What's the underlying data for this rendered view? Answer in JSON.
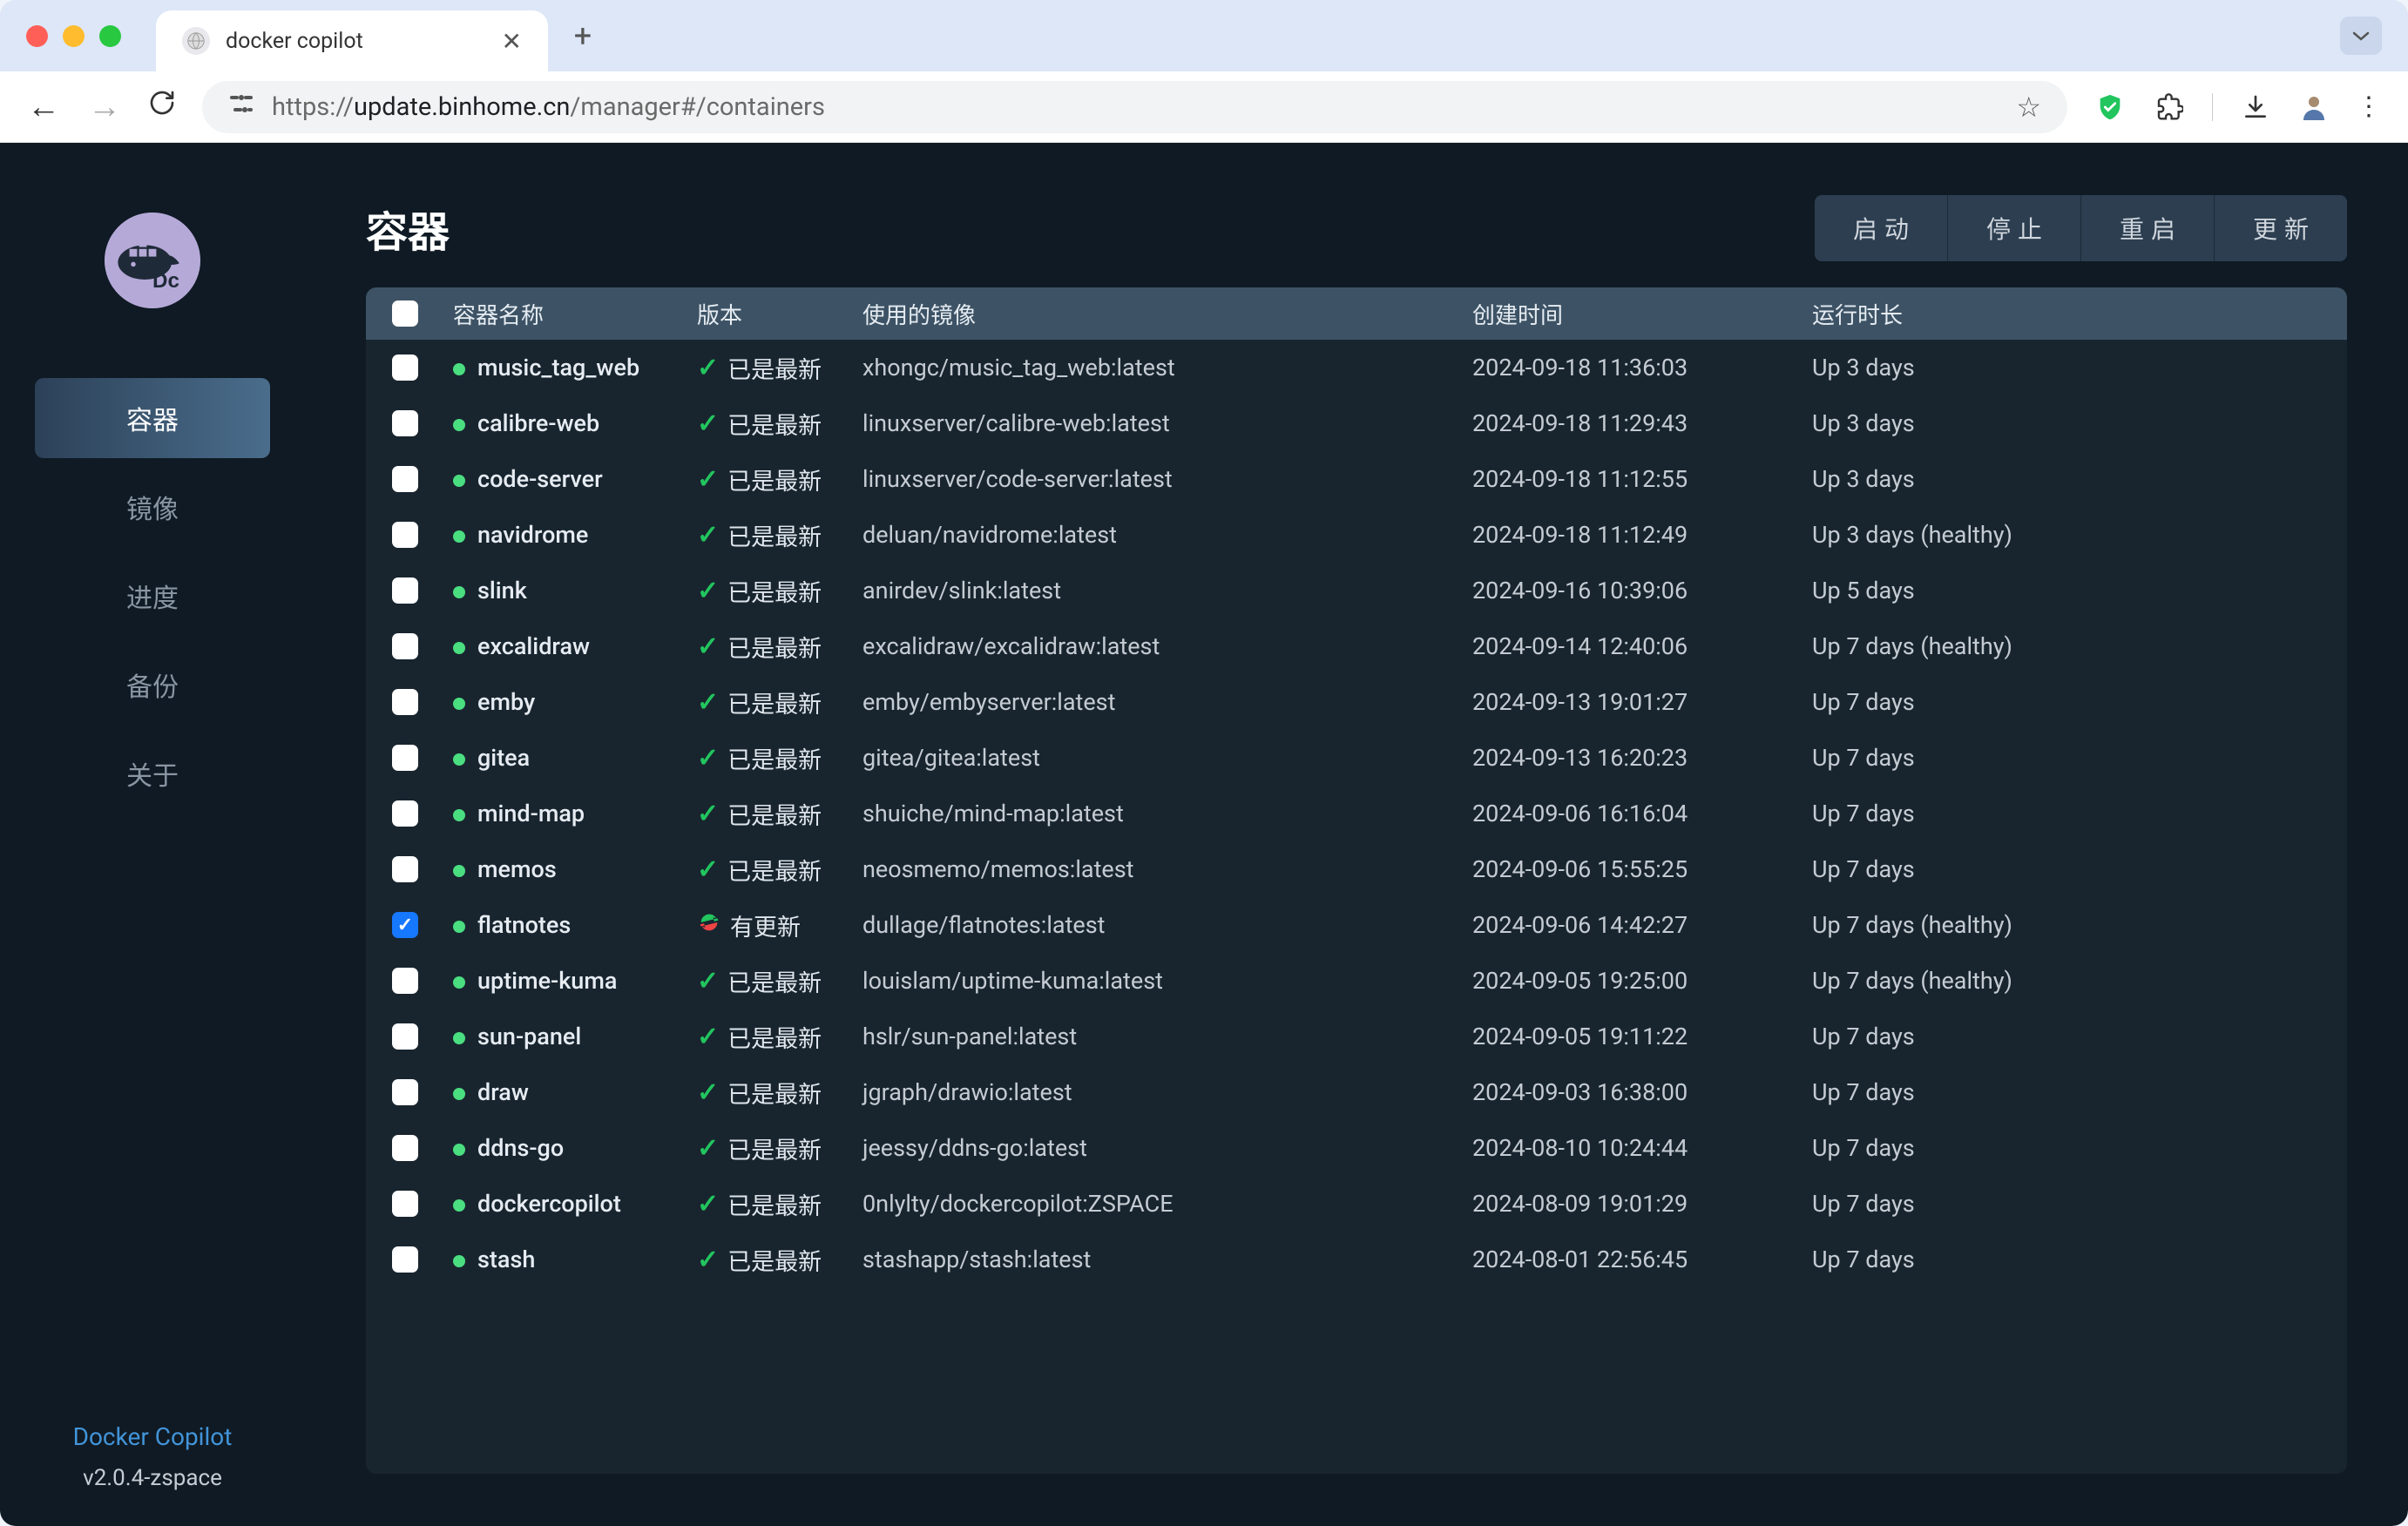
{
  "browser": {
    "tab_title": "docker copilot",
    "url_prefix": "https://",
    "url_host": "update.binhome.cn",
    "url_path": "/manager#/containers"
  },
  "sidebar": {
    "items": [
      {
        "label": "容器",
        "active": true
      },
      {
        "label": "镜像",
        "active": false
      },
      {
        "label": "进度",
        "active": false
      },
      {
        "label": "备份",
        "active": false
      },
      {
        "label": "关于",
        "active": false
      }
    ],
    "footer_name": "Docker Copilot",
    "footer_version": "v2.0.4-zspace"
  },
  "page": {
    "title": "容器",
    "actions": [
      "启动",
      "停止",
      "重启",
      "更新"
    ]
  },
  "table": {
    "headers": {
      "name": "容器名称",
      "version": "版本",
      "image": "使用的镜像",
      "created": "创建时间",
      "uptime": "运行时长"
    },
    "version_labels": {
      "latest": "已是最新",
      "update": "有更新"
    },
    "rows": [
      {
        "checked": false,
        "name": "music_tag_web",
        "status": "latest",
        "image": "xhongc/music_tag_web:latest",
        "created": "2024-09-18 11:36:03",
        "uptime": "Up 3 days"
      },
      {
        "checked": false,
        "name": "calibre-web",
        "status": "latest",
        "image": "linuxserver/calibre-web:latest",
        "created": "2024-09-18 11:29:43",
        "uptime": "Up 3 days"
      },
      {
        "checked": false,
        "name": "code-server",
        "status": "latest",
        "image": "linuxserver/code-server:latest",
        "created": "2024-09-18 11:12:55",
        "uptime": "Up 3 days"
      },
      {
        "checked": false,
        "name": "navidrome",
        "status": "latest",
        "image": "deluan/navidrome:latest",
        "created": "2024-09-18 11:12:49",
        "uptime": "Up 3 days (healthy)"
      },
      {
        "checked": false,
        "name": "slink",
        "status": "latest",
        "image": "anirdev/slink:latest",
        "created": "2024-09-16 10:39:06",
        "uptime": "Up 5 days"
      },
      {
        "checked": false,
        "name": "excalidraw",
        "status": "latest",
        "image": "excalidraw/excalidraw:latest",
        "created": "2024-09-14 12:40:06",
        "uptime": "Up 7 days (healthy)"
      },
      {
        "checked": false,
        "name": "emby",
        "status": "latest",
        "image": "emby/embyserver:latest",
        "created": "2024-09-13 19:01:27",
        "uptime": "Up 7 days"
      },
      {
        "checked": false,
        "name": "gitea",
        "status": "latest",
        "image": "gitea/gitea:latest",
        "created": "2024-09-13 16:20:23",
        "uptime": "Up 7 days"
      },
      {
        "checked": false,
        "name": "mind-map",
        "status": "latest",
        "image": "shuiche/mind-map:latest",
        "created": "2024-09-06 16:16:04",
        "uptime": "Up 7 days"
      },
      {
        "checked": false,
        "name": "memos",
        "status": "latest",
        "image": "neosmemo/memos:latest",
        "created": "2024-09-06 15:55:25",
        "uptime": "Up 7 days"
      },
      {
        "checked": true,
        "name": "flatnotes",
        "status": "update",
        "image": "dullage/flatnotes:latest",
        "created": "2024-09-06 14:42:27",
        "uptime": "Up 7 days (healthy)"
      },
      {
        "checked": false,
        "name": "uptime-kuma",
        "status": "latest",
        "image": "louislam/uptime-kuma:latest",
        "created": "2024-09-05 19:25:00",
        "uptime": "Up 7 days (healthy)"
      },
      {
        "checked": false,
        "name": "sun-panel",
        "status": "latest",
        "image": "hslr/sun-panel:latest",
        "created": "2024-09-05 19:11:22",
        "uptime": "Up 7 days"
      },
      {
        "checked": false,
        "name": "draw",
        "status": "latest",
        "image": "jgraph/drawio:latest",
        "created": "2024-09-03 16:38:00",
        "uptime": "Up 7 days"
      },
      {
        "checked": false,
        "name": "ddns-go",
        "status": "latest",
        "image": "jeessy/ddns-go:latest",
        "created": "2024-08-10 10:24:44",
        "uptime": "Up 7 days"
      },
      {
        "checked": false,
        "name": "dockercopilot",
        "status": "latest",
        "image": "0nlylty/dockercopilot:ZSPACE",
        "created": "2024-08-09 19:01:29",
        "uptime": "Up 7 days"
      },
      {
        "checked": false,
        "name": "stash",
        "status": "latest",
        "image": "stashapp/stash:latest",
        "created": "2024-08-01 22:56:45",
        "uptime": "Up 7 days"
      }
    ]
  }
}
